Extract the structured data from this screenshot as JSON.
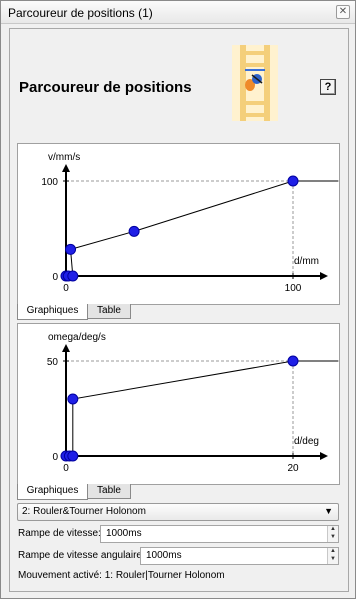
{
  "window": {
    "title": "Parcoureur de positions (1)",
    "close_label": "✕"
  },
  "heading": "Parcoureur de positions",
  "help_label": "?",
  "charts": [
    {
      "type": "line",
      "ylabel": "v/mm/s",
      "xlabel": "d/mm",
      "x_ticks": [
        "0",
        "100"
      ],
      "y_ticks": [
        "0",
        "100"
      ],
      "xlim": [
        0,
        100
      ],
      "ylim": [
        0,
        100
      ],
      "points": [
        [
          0,
          0
        ],
        [
          1,
          0
        ],
        [
          3,
          0
        ],
        [
          2,
          28
        ],
        [
          30,
          47
        ],
        [
          100,
          100
        ]
      ],
      "extend_to_x": 120,
      "reference": [
        100,
        100
      ],
      "point_color": "#1f1fe6"
    },
    {
      "type": "line",
      "ylabel": "omega/deg/s",
      "xlabel": "d/deg",
      "x_ticks": [
        "0",
        "20"
      ],
      "y_ticks": [
        "0",
        "50"
      ],
      "xlim": [
        0,
        20
      ],
      "ylim": [
        0,
        50
      ],
      "points": [
        [
          0,
          0
        ],
        [
          0.3,
          0
        ],
        [
          0.6,
          0
        ],
        [
          0.6,
          30
        ],
        [
          20,
          50
        ]
      ],
      "extend_to_x": 24,
      "reference": [
        20,
        50
      ],
      "point_color": "#1f1fe6"
    }
  ],
  "tabs": [
    [
      {
        "label": "Graphiques"
      },
      {
        "label": "Table"
      }
    ],
    [
      {
        "label": "Graphiques"
      },
      {
        "label": "Table"
      }
    ]
  ],
  "mode_select": {
    "value": "2: Rouler&Tourner Holonom"
  },
  "speed_ramp": {
    "label": "Rampe de vitesse:",
    "value": "1000ms"
  },
  "angular_ramp": {
    "label": "Rampe de vitesse angulaire:",
    "value": "1000ms"
  },
  "status": "Mouvement activé: 1: Rouler|Tourner Holonom"
}
